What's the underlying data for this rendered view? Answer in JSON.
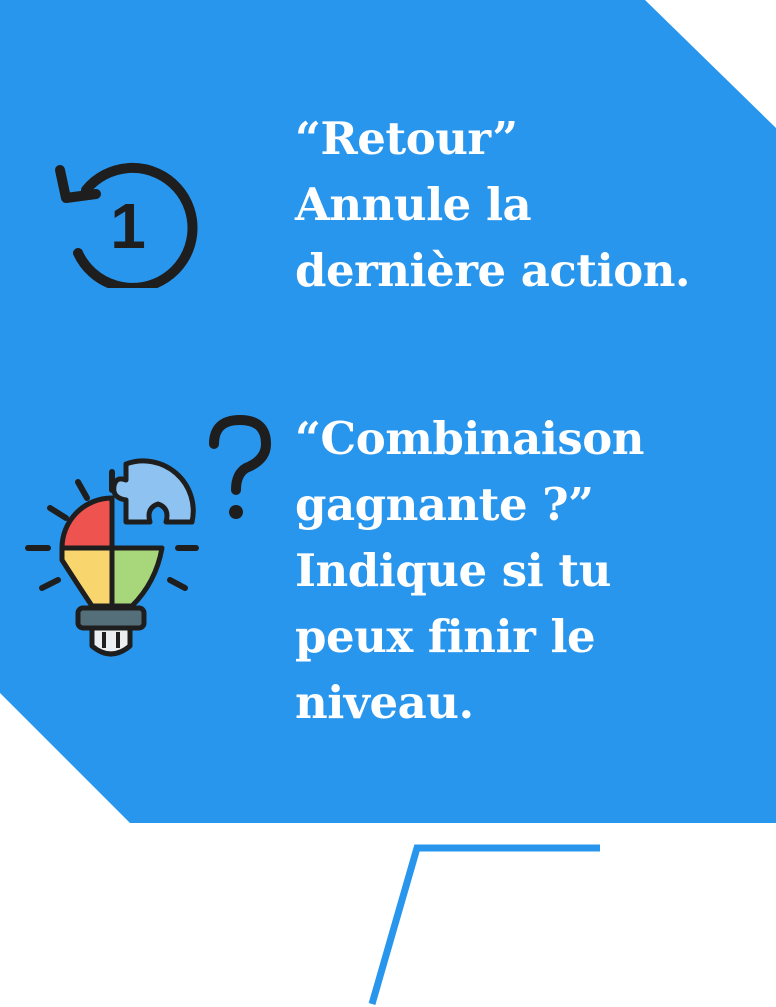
{
  "colors": {
    "panel": "#2996ee",
    "text": "#ffffff",
    "icon_dark": "#1e1e1e",
    "accent_line": "#2996ee"
  },
  "undo": {
    "icon": "undo-one-icon",
    "icon_digit": "1",
    "lines": [
      "“Retour”",
      "Annule la",
      "dernière action."
    ]
  },
  "combination": {
    "icon": "puzzle-lightbulb-icon",
    "question_mark": "?",
    "lines": [
      "“Combinaison",
      "gagnante ?”",
      "Indique si tu",
      "peux finir le",
      "niveau."
    ]
  }
}
